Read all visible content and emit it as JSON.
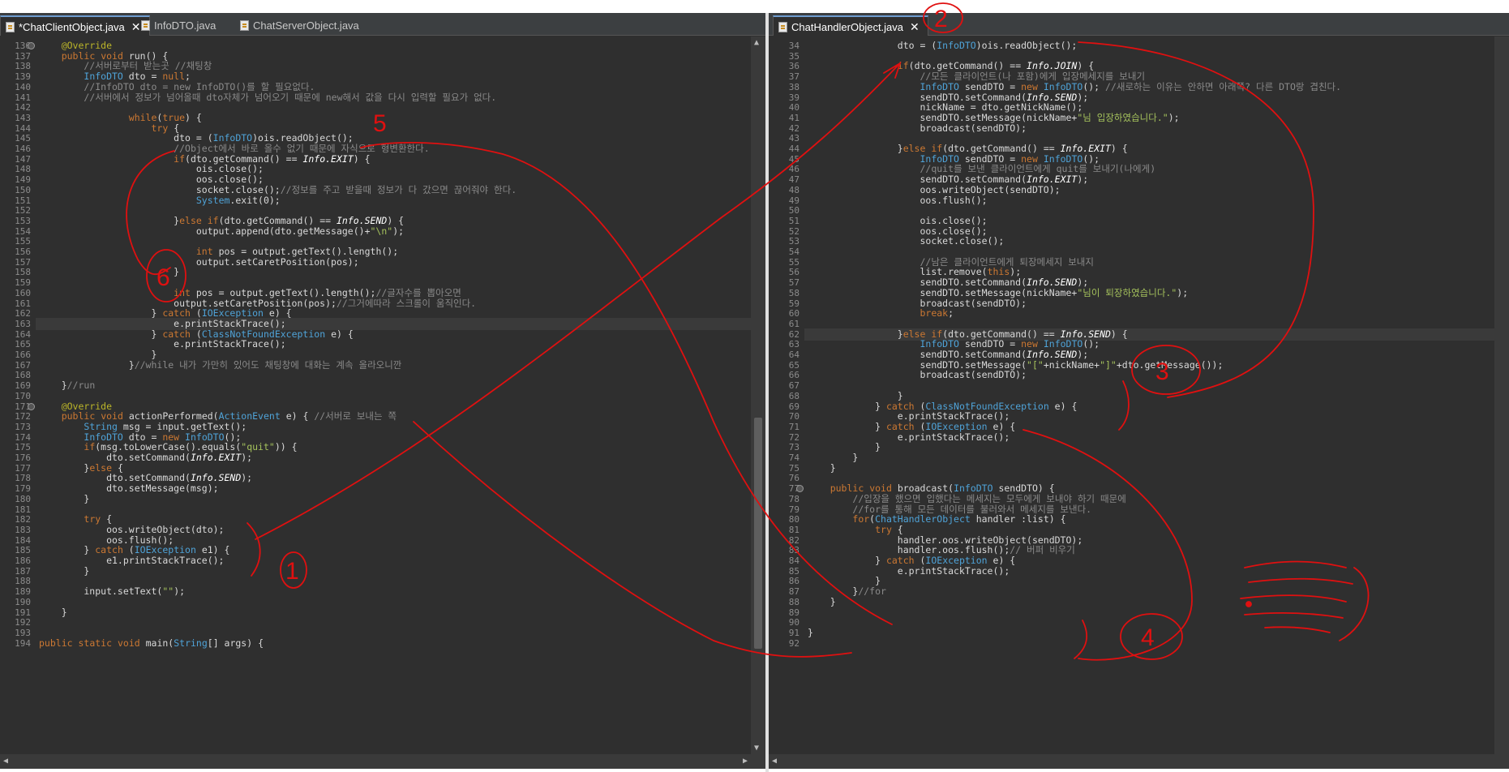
{
  "left_tabs": [
    {
      "label": "*ChatClientObject.java",
      "active": true,
      "has_close": true
    },
    {
      "label": "InfoDTO.java",
      "active": false,
      "has_close": false
    },
    {
      "label": "ChatServerObject.java",
      "active": false,
      "has_close": false
    }
  ],
  "right_tabs": [
    {
      "label": "ChatHandlerObject.java",
      "active": true,
      "has_close": true
    }
  ],
  "close_glyph": "✕",
  "left_code": [
    {
      "n": "136",
      "t": "    @Override"
    },
    {
      "n": "137",
      "t": "    public void run() {"
    },
    {
      "n": "138",
      "t": "        //서버로부터 받는곳 //채팅창"
    },
    {
      "n": "139",
      "t": "        InfoDTO dto = null;"
    },
    {
      "n": "140",
      "t": "        //InfoDTO dto = new InfoDTO()를 할 필요없다."
    },
    {
      "n": "141",
      "t": "        //서버에서 정보가 넘어올때 dto자체가 넘어오기 때문에 new해서 값을 다시 입력할 필요가 없다."
    },
    {
      "n": "142",
      "t": ""
    },
    {
      "n": "143",
      "t": "                while(true) {"
    },
    {
      "n": "144",
      "t": "                    try {"
    },
    {
      "n": "145",
      "t": "                        dto = (InfoDTO)ois.readObject();"
    },
    {
      "n": "146",
      "t": "                        //Object에서 바로 올수 없기 때문에 자식으로 형변환한다."
    },
    {
      "n": "147",
      "t": "                        if(dto.getCommand() == Info.EXIT) {"
    },
    {
      "n": "148",
      "t": "                            ois.close();"
    },
    {
      "n": "149",
      "t": "                            oos.close();"
    },
    {
      "n": "150",
      "t": "                            socket.close();//정보를 주고 받을때 정보가 다 갔으면 끊어줘야 한다."
    },
    {
      "n": "151",
      "t": "                            System.exit(0);"
    },
    {
      "n": "152",
      "t": ""
    },
    {
      "n": "153",
      "t": "                        }else if(dto.getCommand() == Info.SEND) {"
    },
    {
      "n": "154",
      "t": "                            output.append(dto.getMessage()+\"\\n\");"
    },
    {
      "n": "155",
      "t": ""
    },
    {
      "n": "156",
      "t": "                            int pos = output.getText().length();"
    },
    {
      "n": "157",
      "t": "                            output.setCaretPosition(pos);"
    },
    {
      "n": "158",
      "t": "                        }"
    },
    {
      "n": "159",
      "t": ""
    },
    {
      "n": "160",
      "t": "                        int pos = output.getText().length();//글자수를 뽑아오면"
    },
    {
      "n": "161",
      "t": "                        output.setCaretPosition(pos);//그거에따라 스크롤이 움직인다."
    },
    {
      "n": "162",
      "t": "                    } catch (IOException e) {"
    },
    {
      "n": "163",
      "t": "                        e.printStackTrace();"
    },
    {
      "n": "164",
      "t": "                    } catch (ClassNotFoundException e) {"
    },
    {
      "n": "165",
      "t": "                        e.printStackTrace();"
    },
    {
      "n": "166",
      "t": "                    }"
    },
    {
      "n": "167",
      "t": "                }//while 내가 가만히 있어도 채팅창에 대화는 계속 올라오니깐"
    },
    {
      "n": "168",
      "t": ""
    },
    {
      "n": "169",
      "t": "    }//run"
    },
    {
      "n": "170",
      "t": ""
    },
    {
      "n": "171",
      "t": "    @Override"
    },
    {
      "n": "172",
      "t": "    public void actionPerformed(ActionEvent e) { //서버로 보내는 쪽"
    },
    {
      "n": "173",
      "t": "        String msg = input.getText();"
    },
    {
      "n": "174",
      "t": "        InfoDTO dto = new InfoDTO();"
    },
    {
      "n": "175",
      "t": "        if(msg.toLowerCase().equals(\"quit\")) {"
    },
    {
      "n": "176",
      "t": "            dto.setCommand(Info.EXIT);"
    },
    {
      "n": "177",
      "t": "        }else {"
    },
    {
      "n": "178",
      "t": "            dto.setCommand(Info.SEND);"
    },
    {
      "n": "179",
      "t": "            dto.setMessage(msg);"
    },
    {
      "n": "180",
      "t": "        }"
    },
    {
      "n": "181",
      "t": ""
    },
    {
      "n": "182",
      "t": "        try {"
    },
    {
      "n": "183",
      "t": "            oos.writeObject(dto);"
    },
    {
      "n": "184",
      "t": "            oos.flush();"
    },
    {
      "n": "185",
      "t": "        } catch (IOException e1) {"
    },
    {
      "n": "186",
      "t": "            e1.printStackTrace();"
    },
    {
      "n": "187",
      "t": "        }"
    },
    {
      "n": "188",
      "t": ""
    },
    {
      "n": "189",
      "t": "        input.setText(\"\");"
    },
    {
      "n": "190",
      "t": ""
    },
    {
      "n": "191",
      "t": "    }"
    },
    {
      "n": "192",
      "t": ""
    },
    {
      "n": "193",
      "t": ""
    },
    {
      "n": "194",
      "t": "public static void main(String[] args) {"
    }
  ],
  "right_code": [
    {
      "n": "34",
      "t": "                dto = (InfoDTO)ois.readObject();"
    },
    {
      "n": "35",
      "t": ""
    },
    {
      "n": "36",
      "t": "                if(dto.getCommand() == Info.JOIN) {"
    },
    {
      "n": "37",
      "t": "                    //모든 클라이언트(나 포함)에게 입장메세지를 보내기"
    },
    {
      "n": "38",
      "t": "                    InfoDTO sendDTO = new InfoDTO(); //새로하는 이유는 안하면 아래쪽? 다른 DTO랑 겹친다."
    },
    {
      "n": "39",
      "t": "                    sendDTO.setCommand(Info.SEND);"
    },
    {
      "n": "40",
      "t": "                    nickName = dto.getNickName();"
    },
    {
      "n": "41",
      "t": "                    sendDTO.setMessage(nickName+\"님 입장하였습니다.\");"
    },
    {
      "n": "42",
      "t": "                    broadcast(sendDTO);"
    },
    {
      "n": "43",
      "t": ""
    },
    {
      "n": "44",
      "t": "                }else if(dto.getCommand() == Info.EXIT) {"
    },
    {
      "n": "45",
      "t": "                    InfoDTO sendDTO = new InfoDTO();"
    },
    {
      "n": "46",
      "t": "                    //quit를 보낸 클라이언트에게 quit를 보내기(나에게)"
    },
    {
      "n": "47",
      "t": "                    sendDTO.setCommand(Info.EXIT);"
    },
    {
      "n": "48",
      "t": "                    oos.writeObject(sendDTO);"
    },
    {
      "n": "49",
      "t": "                    oos.flush();"
    },
    {
      "n": "50",
      "t": ""
    },
    {
      "n": "51",
      "t": "                    ois.close();"
    },
    {
      "n": "52",
      "t": "                    oos.close();"
    },
    {
      "n": "53",
      "t": "                    socket.close();"
    },
    {
      "n": "54",
      "t": ""
    },
    {
      "n": "55",
      "t": "                    //남은 클라이언트에게 퇴장메세지 보내지"
    },
    {
      "n": "56",
      "t": "                    list.remove(this);"
    },
    {
      "n": "57",
      "t": "                    sendDTO.setCommand(Info.SEND);"
    },
    {
      "n": "58",
      "t": "                    sendDTO.setMessage(nickName+\"님이 퇴장하였습니다.\");"
    },
    {
      "n": "59",
      "t": "                    broadcast(sendDTO);"
    },
    {
      "n": "60",
      "t": "                    break;"
    },
    {
      "n": "61",
      "t": ""
    },
    {
      "n": "62",
      "t": "                }else if(dto.getCommand() == Info.SEND) {"
    },
    {
      "n": "63",
      "t": "                    InfoDTO sendDTO = new InfoDTO();"
    },
    {
      "n": "64",
      "t": "                    sendDTO.setCommand(Info.SEND);"
    },
    {
      "n": "65",
      "t": "                    sendDTO.setMessage(\"[\"+nickName+\"]\"+dto.getMessage());"
    },
    {
      "n": "66",
      "t": "                    broadcast(sendDTO);"
    },
    {
      "n": "67",
      "t": ""
    },
    {
      "n": "68",
      "t": "                }"
    },
    {
      "n": "69",
      "t": "            } catch (ClassNotFoundException e) {"
    },
    {
      "n": "70",
      "t": "                e.printStackTrace();"
    },
    {
      "n": "71",
      "t": "            } catch (IOException e) {"
    },
    {
      "n": "72",
      "t": "                e.printStackTrace();"
    },
    {
      "n": "73",
      "t": "            }"
    },
    {
      "n": "74",
      "t": "        }"
    },
    {
      "n": "75",
      "t": "    }"
    },
    {
      "n": "76",
      "t": ""
    },
    {
      "n": "77",
      "t": "    public void broadcast(InfoDTO sendDTO) {"
    },
    {
      "n": "78",
      "t": "        //입장을 했으면 입했다는 메세지는 모두에게 보내야 하기 때문에"
    },
    {
      "n": "79",
      "t": "        //for를 통해 모든 데이터를 불러와서 메세지를 보낸다."
    },
    {
      "n": "80",
      "t": "        for(ChatHandlerObject handler :list) {"
    },
    {
      "n": "81",
      "t": "            try {"
    },
    {
      "n": "82",
      "t": "                handler.oos.writeObject(sendDTO);"
    },
    {
      "n": "83",
      "t": "                handler.oos.flush();// 버퍼 비우기"
    },
    {
      "n": "84",
      "t": "            } catch (IOException e) {"
    },
    {
      "n": "85",
      "t": "                e.printStackTrace();"
    },
    {
      "n": "86",
      "t": "            }"
    },
    {
      "n": "87",
      "t": "        }//for"
    },
    {
      "n": "88",
      "t": "    }"
    },
    {
      "n": "89",
      "t": ""
    },
    {
      "n": "90",
      "t": ""
    },
    {
      "n": "91",
      "t": "}"
    },
    {
      "n": "92",
      "t": ""
    }
  ],
  "annotations": [
    "1",
    "2",
    "3",
    "4",
    "5",
    "6"
  ],
  "annotation_color": "#e01010",
  "keyword_color": "#cc7832",
  "type_color": "#4fa3d8",
  "string_color": "#a5c25c",
  "comment_color": "#8a8a8a"
}
